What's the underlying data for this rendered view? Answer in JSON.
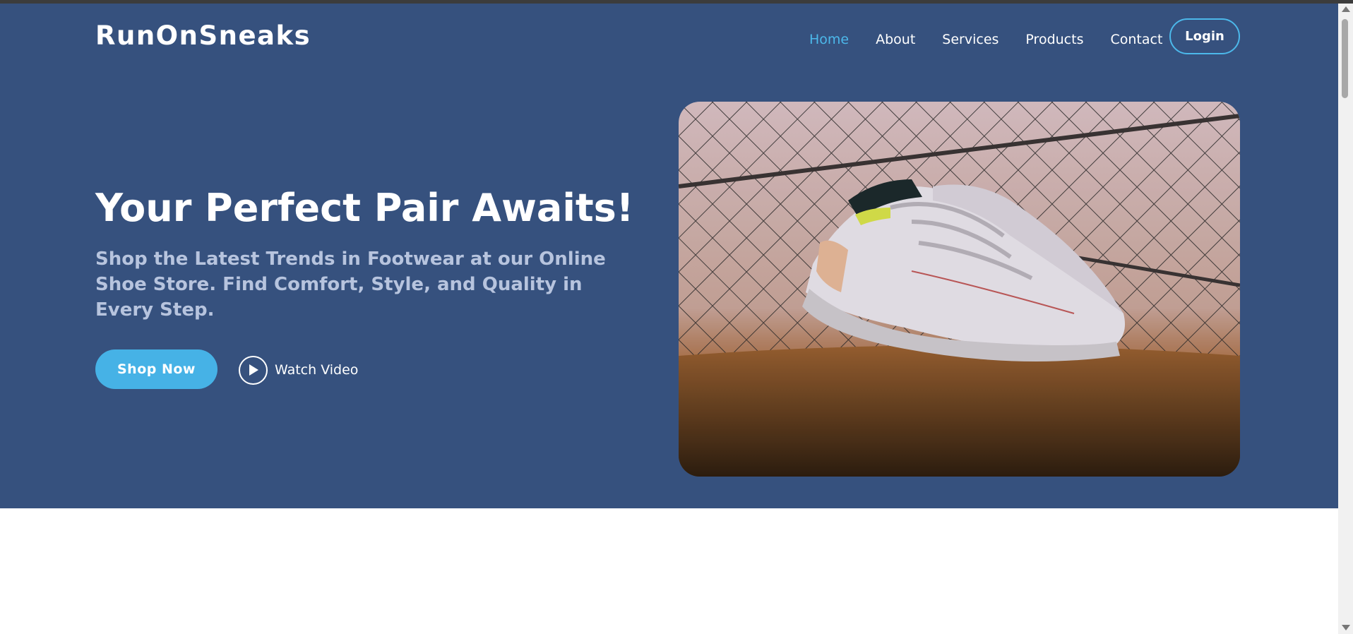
{
  "brand": {
    "name": "RunOnSneaks"
  },
  "nav": {
    "items": [
      {
        "label": "Home",
        "active": true
      },
      {
        "label": "About",
        "active": false
      },
      {
        "label": "Services",
        "active": false
      },
      {
        "label": "Products",
        "active": false
      },
      {
        "label": "Contact",
        "active": false
      }
    ],
    "login_label": "Login"
  },
  "hero": {
    "headline": "Your Perfect Pair Awaits!",
    "subhead": "Shop the Latest Trends in Footwear at our Online Shoe Store. Find Comfort, Style, and Quality in Every Step.",
    "shop_button": "Shop Now",
    "watch_label": "Watch Video",
    "image_icon": "sneaker-photo"
  },
  "colors": {
    "hero_bg": "#36517e",
    "accent": "#46b2e6",
    "nav_active": "#4cb8ea",
    "subhead": "#b7c4de"
  }
}
